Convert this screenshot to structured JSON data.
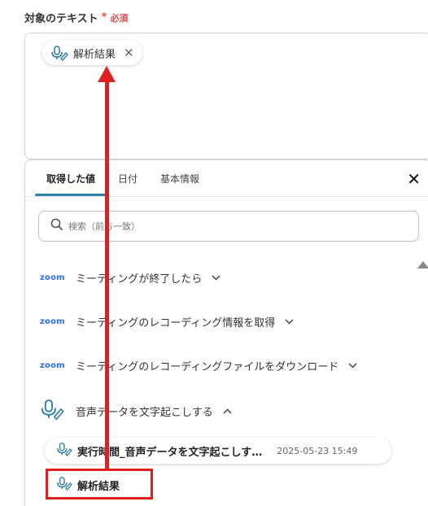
{
  "field": {
    "label": "対象のテキスト",
    "asterisk": "*",
    "required": "必須"
  },
  "chip": {
    "label": "解析結果",
    "icon": "mic-pen-icon",
    "close": "✕"
  },
  "tabs": [
    {
      "label": "取得した値",
      "active": true
    },
    {
      "label": "日付",
      "active": false
    },
    {
      "label": "基本情報",
      "active": false
    }
  ],
  "panel": {
    "close": "✕"
  },
  "search": {
    "placeholder": "検索（前方一致）"
  },
  "sources": [
    {
      "app": "zoom",
      "label": "ミーティングが終了したら",
      "chevron": "⌄"
    },
    {
      "app": "zoom",
      "label": "ミーティングのレコーディング情報を取得",
      "chevron": "⌄"
    },
    {
      "app": "zoom",
      "label": "ミーティングのレコーディングファイルをダウンロード",
      "chevron": "⌄"
    },
    {
      "app": "mic",
      "label": "音声データを文字起こしする",
      "chevron": "^"
    }
  ],
  "outputs": {
    "item1": {
      "name": "実行時間_音声データを文字起こしす…",
      "timestamp": "2025-05-23 15:49"
    },
    "item2": {
      "name": "解析結果"
    }
  },
  "colors": {
    "accent": "#2f7fa5",
    "annotation": "#e02020",
    "zoom": "#2d6ef0",
    "required": "#e5484d"
  }
}
